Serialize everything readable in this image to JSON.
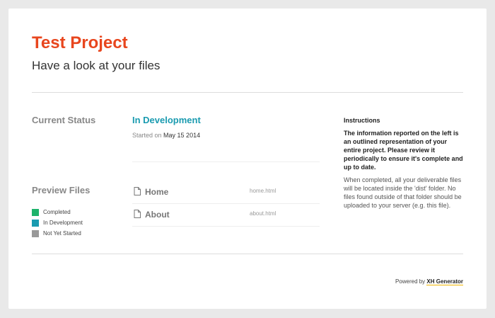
{
  "header": {
    "title": "Test Project",
    "subtitle": "Have a look at your files"
  },
  "status": {
    "label": "Current Status",
    "value": "In Development",
    "started_prefix": "Started on",
    "started_date": "May 15 2014",
    "value_color": "#1a9bb0"
  },
  "preview": {
    "label": "Preview Files",
    "legend": [
      {
        "label": "Completed",
        "color": "#1db36b"
      },
      {
        "label": "In Development",
        "color": "#1a9bb0"
      },
      {
        "label": "Not Yet Started",
        "color": "#999999"
      }
    ],
    "files": [
      {
        "name": "Home",
        "path": "home.html",
        "icon": "file-icon"
      },
      {
        "name": "About",
        "path": "about.html",
        "icon": "file-icon"
      }
    ]
  },
  "instructions": {
    "title": "Instructions",
    "bold_text": "The information reported on the left is an outlined representation of your entire project. Please review it periodically to ensure it's complete and up to date.",
    "text": "When completed, all your deliverable files will be located inside the 'dist' folder. No files found outside of that folder should be uploaded to your server (e.g. this file)."
  },
  "footer": {
    "powered_by": "Powered by",
    "brand": "XH Generator"
  },
  "colors": {
    "accent": "#e8461e",
    "in_development": "#1a9bb0",
    "completed": "#1db36b",
    "not_started": "#999999"
  }
}
